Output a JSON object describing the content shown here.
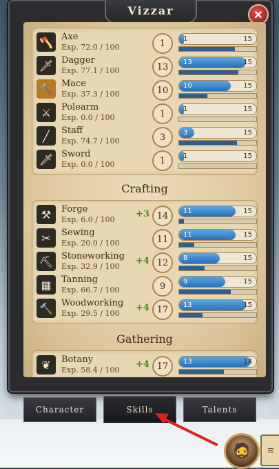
{
  "window": {
    "title": "Vizzar",
    "close_label": "✕"
  },
  "sections": {
    "crafting_title": "Crafting",
    "gathering_title": "Gathering"
  },
  "weapons": [
    {
      "name": "Axe",
      "exp": "Exp. 72.0 / 100",
      "level": "1",
      "bar_level": "1",
      "bar_max": "15",
      "level_fill": 0.0,
      "exp_fill": 0.72,
      "icon": "axe-icon",
      "glyph": "🪓",
      "active": false
    },
    {
      "name": "Dagger",
      "exp": "Exp. 77.1 / 100",
      "level": "13",
      "bar_level": "13",
      "bar_max": "15",
      "level_fill": 0.87,
      "exp_fill": 0.77,
      "icon": "dagger-icon",
      "glyph": "🗡",
      "active": false
    },
    {
      "name": "Mace",
      "exp": "Exp. 37.3 / 100",
      "level": "10",
      "bar_level": "10",
      "bar_max": "15",
      "level_fill": 0.67,
      "exp_fill": 0.37,
      "icon": "mace-icon",
      "glyph": "🔨",
      "active": true
    },
    {
      "name": "Polearm",
      "exp": "Exp. 0.0 / 100",
      "level": "1",
      "bar_level": "1",
      "bar_max": "15",
      "level_fill": 0.0,
      "exp_fill": 0.0,
      "icon": "polearm-icon",
      "glyph": "⚔",
      "active": false
    },
    {
      "name": "Staff",
      "exp": "Exp. 74.7 / 100",
      "level": "3",
      "bar_level": "3",
      "bar_max": "15",
      "level_fill": 0.2,
      "exp_fill": 0.75,
      "icon": "staff-icon",
      "glyph": "╱",
      "active": false
    },
    {
      "name": "Sword",
      "exp": "Exp. 0.0 / 100",
      "level": "1",
      "bar_level": "1",
      "bar_max": "15",
      "level_fill": 0.0,
      "exp_fill": 0.0,
      "icon": "sword-icon",
      "glyph": "🗡",
      "active": false
    }
  ],
  "crafting": [
    {
      "name": "Forge",
      "exp": "Exp. 6.0 / 100",
      "bonus": "+3",
      "level": "14",
      "bar_level": "11",
      "bar_max": "15",
      "level_fill": 0.73,
      "exp_fill": 0.06,
      "icon": "anvil-icon",
      "glyph": "⚒"
    },
    {
      "name": "Sewing",
      "exp": "Exp. 20.0 / 100",
      "bonus": "",
      "level": "11",
      "bar_level": "11",
      "bar_max": "15",
      "level_fill": 0.73,
      "exp_fill": 0.2,
      "icon": "scissors-icon",
      "glyph": "✂"
    },
    {
      "name": "Stoneworking",
      "exp": "Exp. 32.9 / 100",
      "bonus": "+4",
      "level": "12",
      "bar_level": "8",
      "bar_max": "15",
      "level_fill": 0.53,
      "exp_fill": 0.33,
      "icon": "chisel-icon",
      "glyph": "⛏"
    },
    {
      "name": "Tanning",
      "exp": "Exp. 66.7 / 100",
      "bonus": "",
      "level": "9",
      "bar_level": "9",
      "bar_max": "15",
      "level_fill": 0.6,
      "exp_fill": 0.67,
      "icon": "hide-frame-icon",
      "glyph": "▦"
    },
    {
      "name": "Woodworking",
      "exp": "Exp. 29.5 / 100",
      "bonus": "+4",
      "level": "17",
      "bar_level": "13",
      "bar_max": "15",
      "level_fill": 0.87,
      "exp_fill": 0.3,
      "icon": "hammer-icon",
      "glyph": "🔨"
    }
  ],
  "gathering": [
    {
      "name": "Botany",
      "exp": "Exp. 58.4 / 100",
      "bonus": "+4",
      "level": "17",
      "bar_level": "13",
      "bar_max": "14",
      "level_fill": 0.93,
      "exp_fill": 0.58,
      "icon": "leaf-icon",
      "glyph": "❦"
    }
  ],
  "tabs": [
    {
      "id": "character",
      "label": "Character"
    },
    {
      "id": "skills",
      "label": "Skills",
      "active": true
    },
    {
      "id": "talents",
      "label": "Talents"
    }
  ],
  "colors": {
    "level_bar": "#2a70b8",
    "bonus": "#4c8b2a",
    "close": "#c52828",
    "arrow": "#e01f1f"
  }
}
